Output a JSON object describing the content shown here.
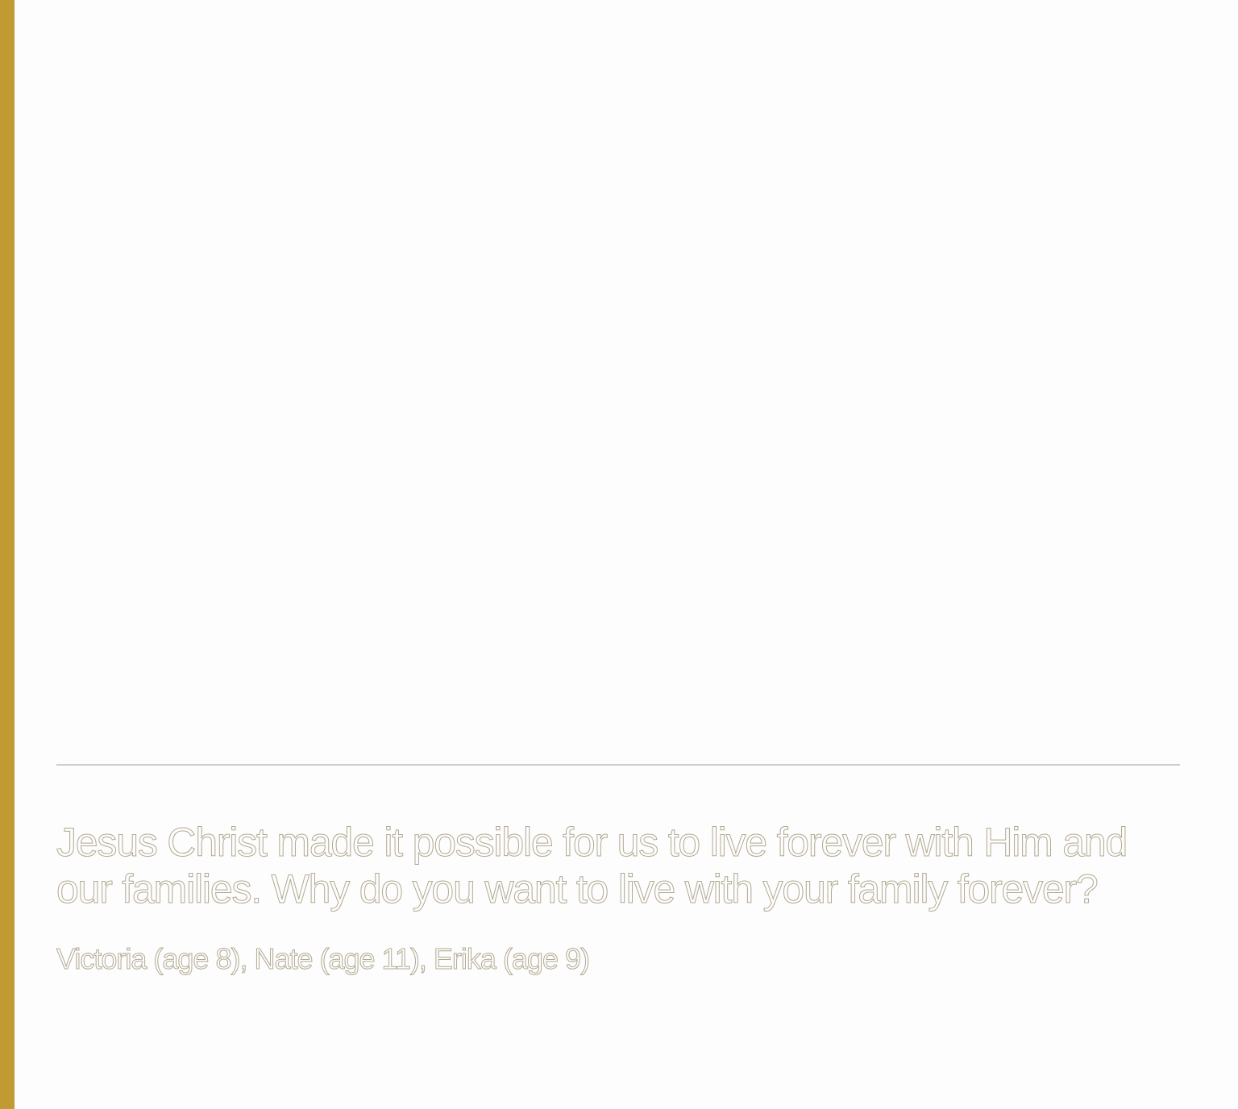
{
  "colors": {
    "accent_bar": "#c09a33",
    "background": "#fdfdfd",
    "divider": "#cfcfcf",
    "text_outline": "#b2a991"
  },
  "quote": {
    "question": "Jesus Christ made it possible for us to live forever with Him and our families. Why do you want to live with your family forever?",
    "authors": "Victoria (age 8), Nate (age 11), Erika (age 9)"
  }
}
